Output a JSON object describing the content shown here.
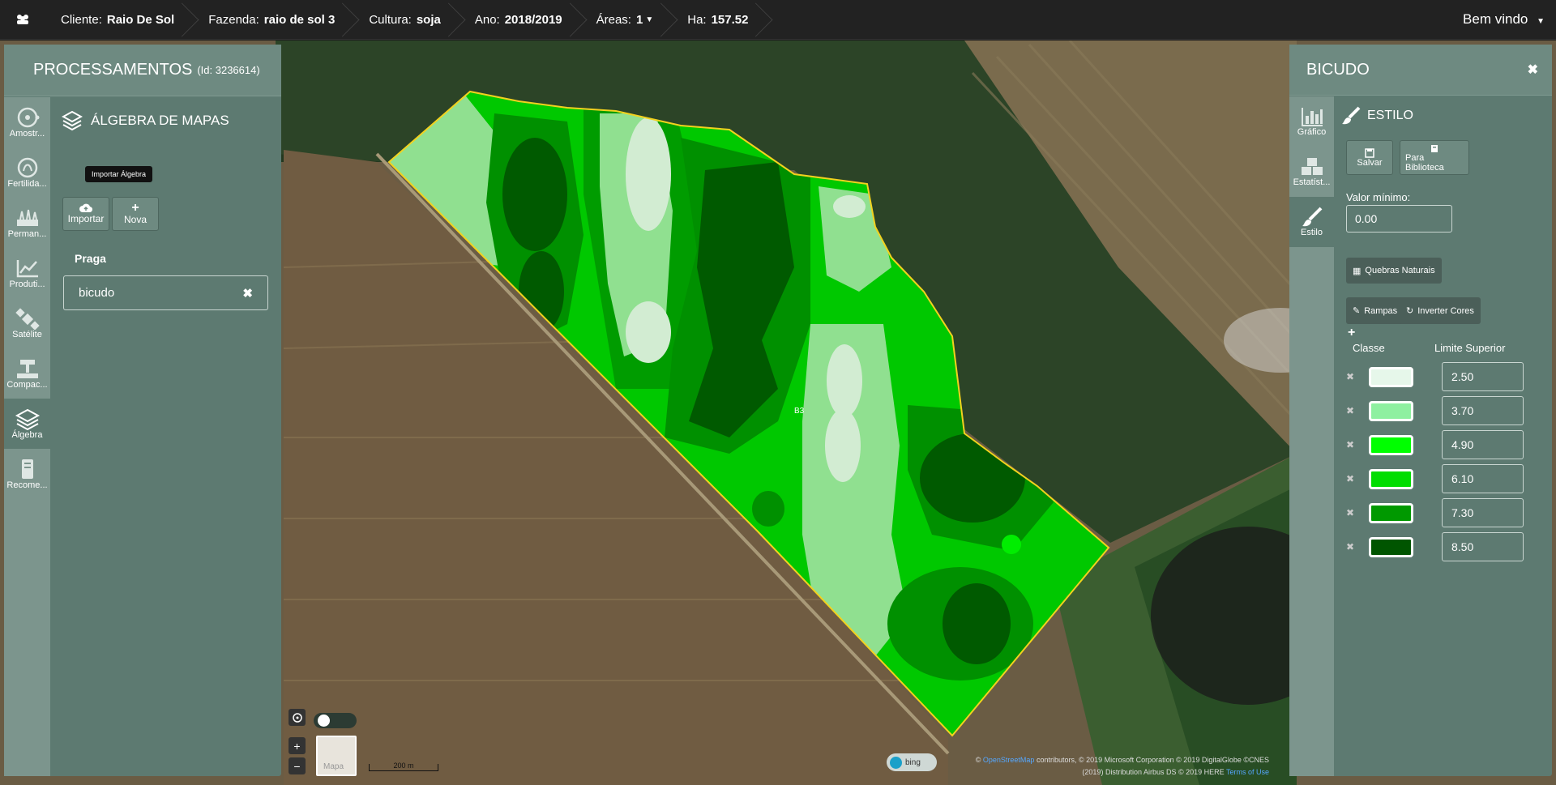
{
  "topbar": {
    "crumbs": [
      {
        "label": "Cliente:",
        "value": "Raio De Sol"
      },
      {
        "label": "Fazenda:",
        "value": "raio de sol 3"
      },
      {
        "label": "Cultura:",
        "value": "soja"
      },
      {
        "label": "Ano:",
        "value": "2018/2019"
      },
      {
        "label": "Áreas:",
        "value": "1"
      },
      {
        "label": "Ha:",
        "value": "157.52"
      }
    ],
    "welcome": "Bem vindo"
  },
  "left_panel": {
    "title": "PROCESSAMENTOS",
    "id_text": "(Id: 3236614)",
    "nav": [
      {
        "label": "Amostr...",
        "icon": "sampling-icon"
      },
      {
        "label": "Fertilida...",
        "icon": "fertility-icon"
      },
      {
        "label": "Perman...",
        "icon": "permanent-icon"
      },
      {
        "label": "Produti...",
        "icon": "productivity-icon"
      },
      {
        "label": "Satélite",
        "icon": "satellite-icon"
      },
      {
        "label": "Compac...",
        "icon": "compaction-icon"
      },
      {
        "label": "Álgebra",
        "icon": "layers-icon"
      },
      {
        "label": "Recome...",
        "icon": "recommendation-icon"
      }
    ],
    "section_title": "ÁLGEBRA DE MAPAS",
    "tooltip": "Importar Álgebra",
    "import_label": "Importar",
    "new_label": "Nova",
    "praga_label": "Praga",
    "praga_value": "bicudo"
  },
  "right_panel": {
    "title": "BICUDO",
    "nav": [
      {
        "label": "Gráfico",
        "icon": "chart-icon"
      },
      {
        "label": "Estatíst...",
        "icon": "statistics-icon"
      },
      {
        "label": "Estilo",
        "icon": "brush-icon"
      }
    ],
    "estilo_title": "ESTILO",
    "save_label": "Salvar",
    "library_label": "Para Biblioteca",
    "valor_minimo_label": "Valor mínimo:",
    "valor_minimo": "0.00",
    "quebras_label": "Quebras Naturais",
    "rampas_label": "Rampas",
    "inverter_label": "Inverter Cores",
    "col_classe": "Classe",
    "col_limite": "Limite Superior",
    "classes": [
      {
        "color": "#e6f7ea",
        "limit": "2.50"
      },
      {
        "color": "#8ef0a0",
        "limit": "3.70"
      },
      {
        "color": "#00ff00",
        "limit": "4.90"
      },
      {
        "color": "#00dd00",
        "limit": "6.10"
      },
      {
        "color": "#009900",
        "limit": "7.30"
      },
      {
        "color": "#005500",
        "limit": "8.50"
      }
    ]
  },
  "map": {
    "label": "B3",
    "basemap_label": "Mapa",
    "scale_label": "200 m",
    "bing_label": "bing",
    "attribution_link": "OpenStreetMap",
    "attribution_line1": "contributors, © 2019 Microsoft Corporation © 2019 DigitalGlobe ©CNES",
    "attribution_line2": "(2019) Distribution Airbus DS © 2019 HERE",
    "terms_link": "Terms of Use",
    "zoom_in": "+",
    "zoom_out": "−"
  }
}
